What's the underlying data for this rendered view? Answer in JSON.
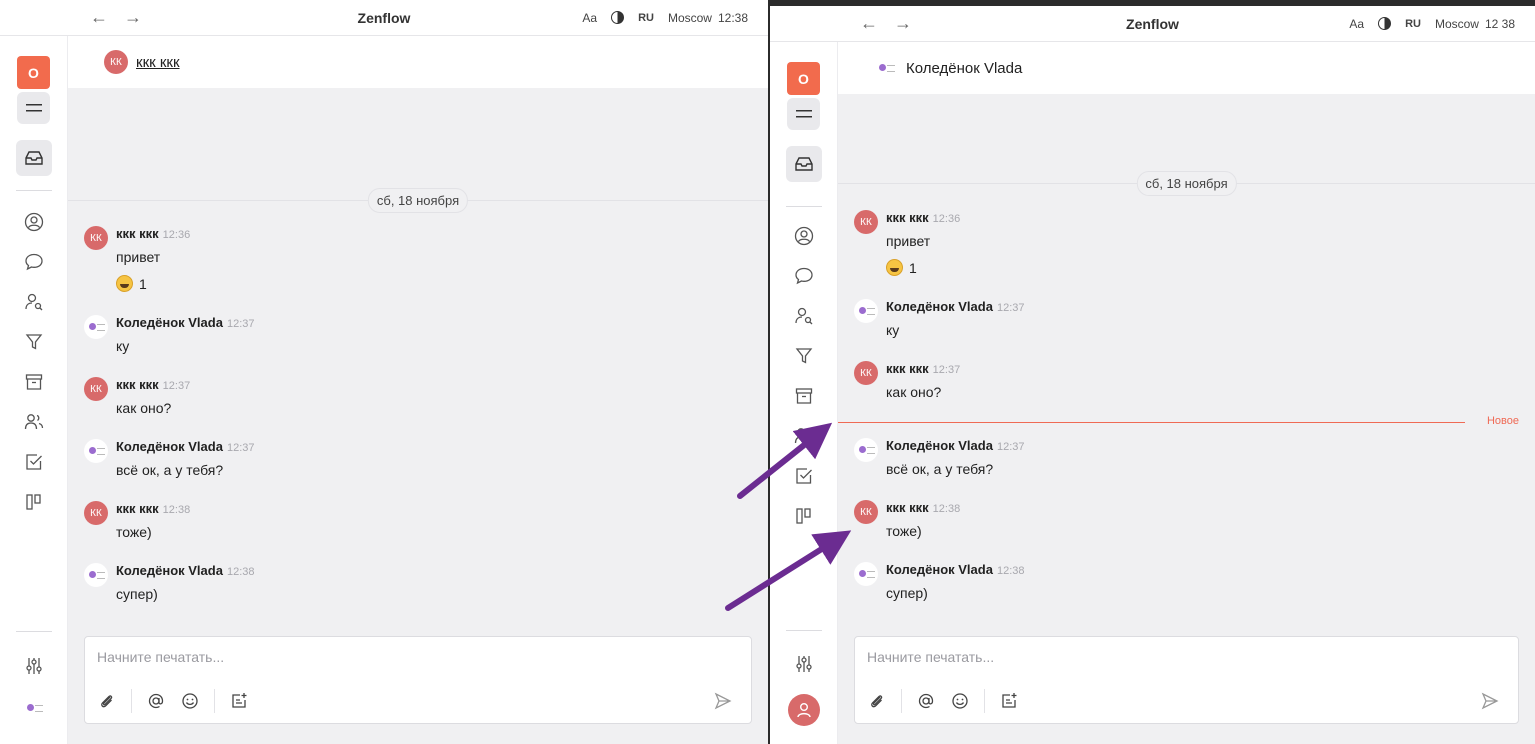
{
  "app_title": "Zenflow",
  "nav": {
    "back": "←",
    "forward": "→"
  },
  "toolbar": {
    "font_size": "Aa",
    "language": "RU",
    "city": "Moscow",
    "time_left": "12:38",
    "time_right": "12 38"
  },
  "sidebar": {
    "org_initial": "О"
  },
  "left": {
    "chat_title": "ккк ккк",
    "date": "сб, 18 ноября",
    "messages": [
      {
        "author": "ккк ккк",
        "time": "12:36",
        "text": "привет",
        "avatar": "КК",
        "reaction": {
          "emoji": "grin",
          "count": "1"
        }
      },
      {
        "author": "Коледёнок Vlada",
        "time": "12:37",
        "text": "ку"
      },
      {
        "author": "ккк ккк",
        "time": "12:37",
        "text": "как оно?",
        "avatar": "КК"
      },
      {
        "author": "Коледёнок Vlada",
        "time": "12:37",
        "text": "всё ок, а у тебя?"
      },
      {
        "author": "ккк ккк",
        "time": "12:38",
        "text": "тоже)",
        "avatar": "КК"
      },
      {
        "author": "Коледёнок Vlada",
        "time": "12:38",
        "text": "супер)"
      }
    ],
    "composer_placeholder": "Начните печатать..."
  },
  "right": {
    "chat_title": "Коледёнок Vlada",
    "date": "сб, 18 ноября",
    "new_label": "Новое",
    "messages": [
      {
        "author": "ккк ккк",
        "time": "12:36",
        "text": "привет",
        "avatar": "КК",
        "reaction": {
          "emoji": "grin",
          "count": "1"
        }
      },
      {
        "author": "Коледёнок Vlada",
        "time": "12:37",
        "text": "ку"
      },
      {
        "author": "ккк ккк",
        "time": "12:37",
        "text": "как оно?",
        "avatar": "КК"
      },
      {
        "author": "Коледёнок Vlada",
        "time": "12:37",
        "text": "всё ок, а у тебя?"
      },
      {
        "author": "ккк ккк",
        "time": "12:38",
        "text": "тоже)",
        "avatar": "КК"
      },
      {
        "author": "Коледёнок Vlada",
        "time": "12:38",
        "text": "супер)"
      }
    ],
    "composer_placeholder": "Начните печатать..."
  },
  "colors": {
    "accent": "#f26b4d",
    "avatar": "#d86a6a",
    "new_divider": "#ef6a55",
    "annotation_arrow": "#6b2c91"
  }
}
